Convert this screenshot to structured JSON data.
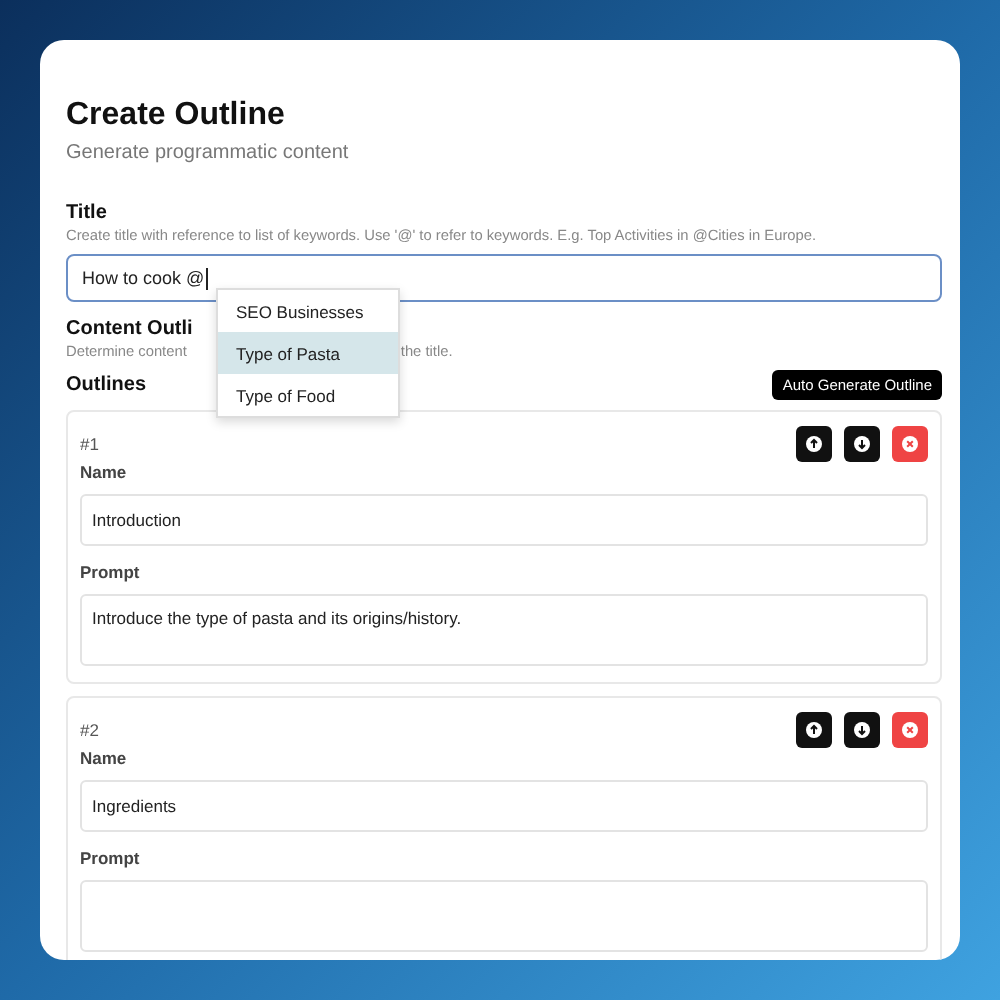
{
  "header": {
    "title": "Create Outline",
    "subtitle": "Generate programmatic content"
  },
  "title_field": {
    "label": "Title",
    "hint": "Create title with reference to list of keywords. Use '@' to refer to keywords. E.g. Top Activities in @Cities in Europe.",
    "value": "How to cook @"
  },
  "mention_menu": [
    {
      "label": "SEO Businesses",
      "selected": false
    },
    {
      "label": "Type of Pasta",
      "selected": true
    },
    {
      "label": "Type of Food",
      "selected": false
    }
  ],
  "content_outline": {
    "label": "Content Outli",
    "hint_parts": [
      "Determine content",
      "the title."
    ]
  },
  "outlines_label": "Outlines",
  "auto_button": "Auto Generate Outline",
  "outlines": [
    {
      "number": "#1",
      "name_label": "Name",
      "name": "Introduction",
      "prompt_label": "Prompt",
      "prompt": "Introduce the type of pasta and its origins/history."
    },
    {
      "number": "#2",
      "name_label": "Name",
      "name": "Ingredients",
      "prompt_label": "Prompt"
    }
  ]
}
